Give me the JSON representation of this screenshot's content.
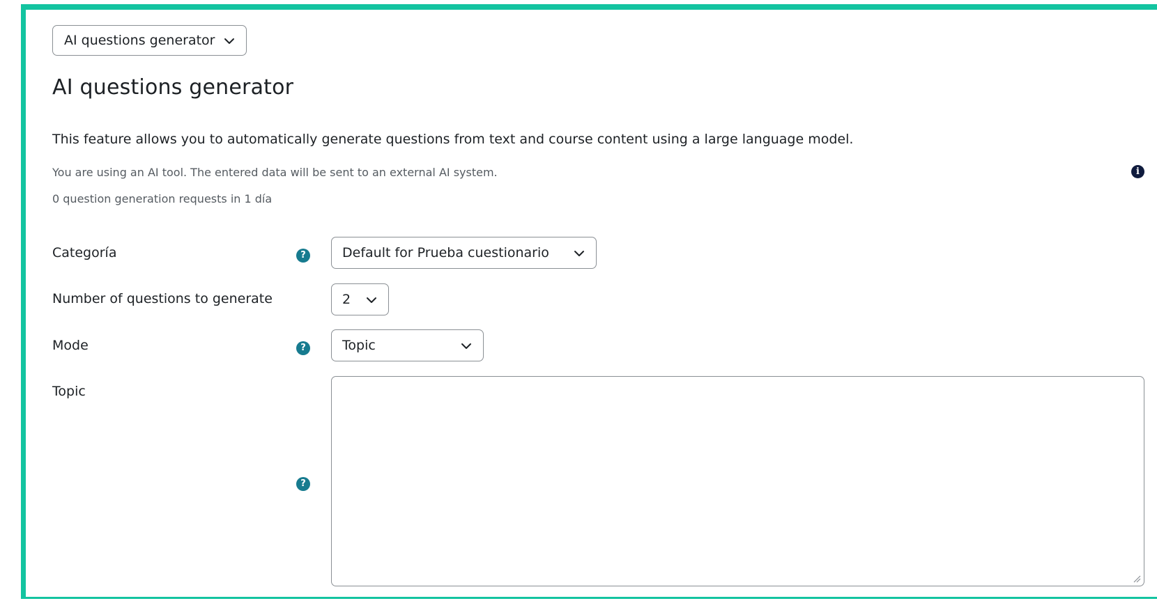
{
  "top_selector": {
    "value": "AI questions generator"
  },
  "page_title": "AI questions generator",
  "description": "This feature allows you to automatically generate questions from text and course content using a large language model.",
  "ai_notice": "You are using an AI tool. The entered data will be sent to an external AI system.",
  "request_count": "0 question generation requests in 1 día",
  "form": {
    "category": {
      "label": "Categoría",
      "value": "Default for Prueba cuestionario"
    },
    "num_questions": {
      "label": "Number of questions to generate",
      "value": "2"
    },
    "mode": {
      "label": "Mode",
      "value": "Topic"
    },
    "topic": {
      "label": "Topic",
      "value": ""
    }
  },
  "icons": {
    "help": "?",
    "info": "i"
  },
  "colors": {
    "accent_border": "#13c4a0",
    "help_icon": "#177b8f",
    "info_icon": "#0f1b3d"
  }
}
